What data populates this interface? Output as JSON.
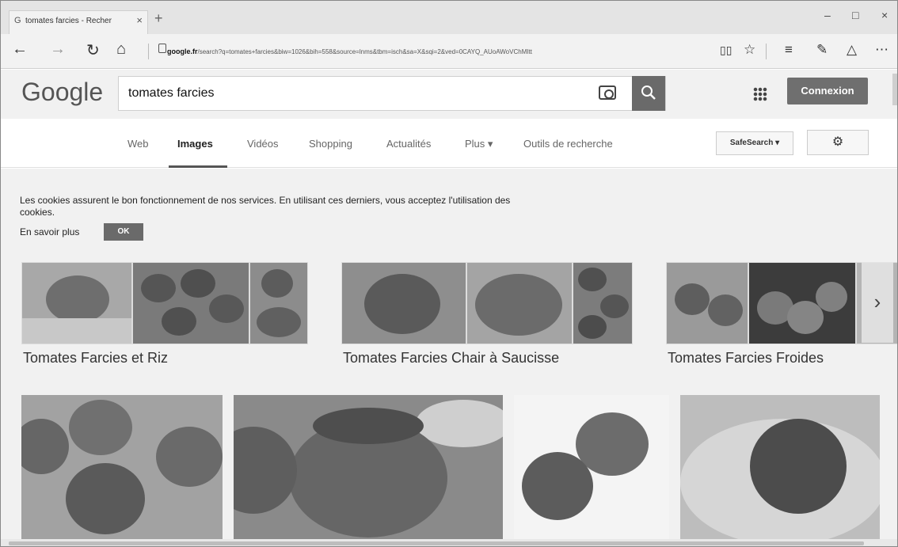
{
  "browser": {
    "tab_title": "tomates farcies - Recher",
    "tab_favicon": "G",
    "tab_close": "×",
    "new_tab": "+",
    "url_domain": "google.fr",
    "url_path": "/search?q=tomates+farcies&biw=1026&bih=558&source=lnms&tbm=isch&sa=X&sqi=2&ved=0CAYQ_AUoAWoVChMItt",
    "min": "–",
    "max": "□",
    "close": "×"
  },
  "header": {
    "logo": "Google",
    "search_query": "tomates farcies",
    "search_icon": "magnifier-icon",
    "connexion_label": "Connexion"
  },
  "tabs": [
    {
      "label": "Web"
    },
    {
      "label": "Images"
    },
    {
      "label": "Vidéos"
    },
    {
      "label": "Shopping"
    },
    {
      "label": "Actualités"
    },
    {
      "label": "Plus ▾"
    },
    {
      "label": "Outils de recherche"
    }
  ],
  "safesearch_label": "SafeSearch ▾",
  "cookies": {
    "text": "Les cookies assurent le bon fonctionnement de nos services. En utilisant ces derniers, vous acceptez l'utilisation des cookies.",
    "more": "En savoir plus",
    "ok": "OK"
  },
  "related": [
    {
      "label": "Tomates Farcies et Riz"
    },
    {
      "label": "Tomates Farcies Chair à Saucisse"
    },
    {
      "label": "Tomates Farcies Froides"
    }
  ],
  "colors": {
    "accent_button": "#6a6a6a",
    "header_bg": "#f1f1f1",
    "page_bg": "#f1f1f1"
  }
}
